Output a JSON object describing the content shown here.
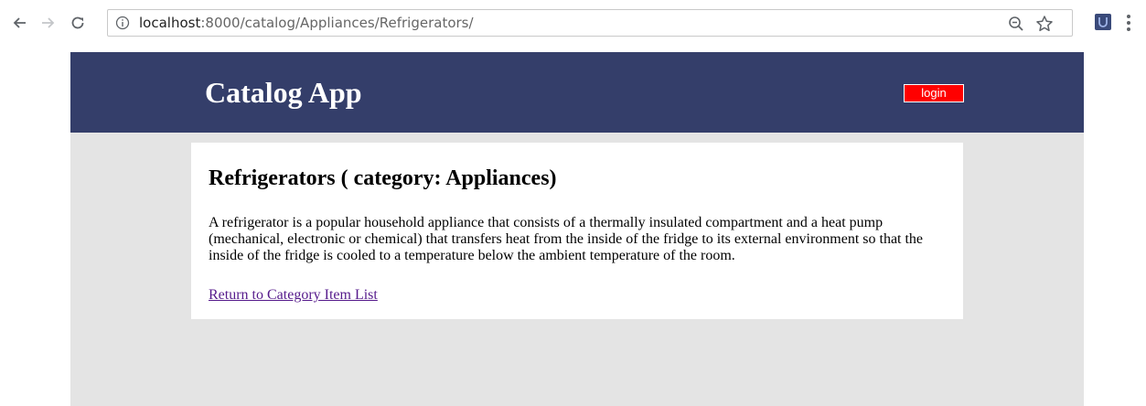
{
  "browser": {
    "url_host": "localhost",
    "url_path": ":8000/catalog/Appliances/Refrigerators/",
    "icons": {
      "back": "back-arrow-icon",
      "forward": "forward-arrow-icon",
      "reload": "reload-icon",
      "info": "info-icon",
      "zoom": "zoom-out-icon",
      "bookmark": "star-icon",
      "extension": "extension-icon",
      "menu": "kebab-menu-icon"
    }
  },
  "header": {
    "title": "Catalog App",
    "login_label": "login",
    "background_color": "#343e6a",
    "login_color": "#ff0000"
  },
  "item": {
    "title": "Refrigerators ( category: Appliances)",
    "description": "A refrigerator is a popular household appliance that consists of a thermally insulated compartment and a heat pump (mechanical, electronic or chemical) that transfers heat from the inside of the fridge to its external environment so that the inside of the fridge is cooled to a temperature below the ambient temperature of the room.",
    "return_link": "Return to Category Item List"
  }
}
